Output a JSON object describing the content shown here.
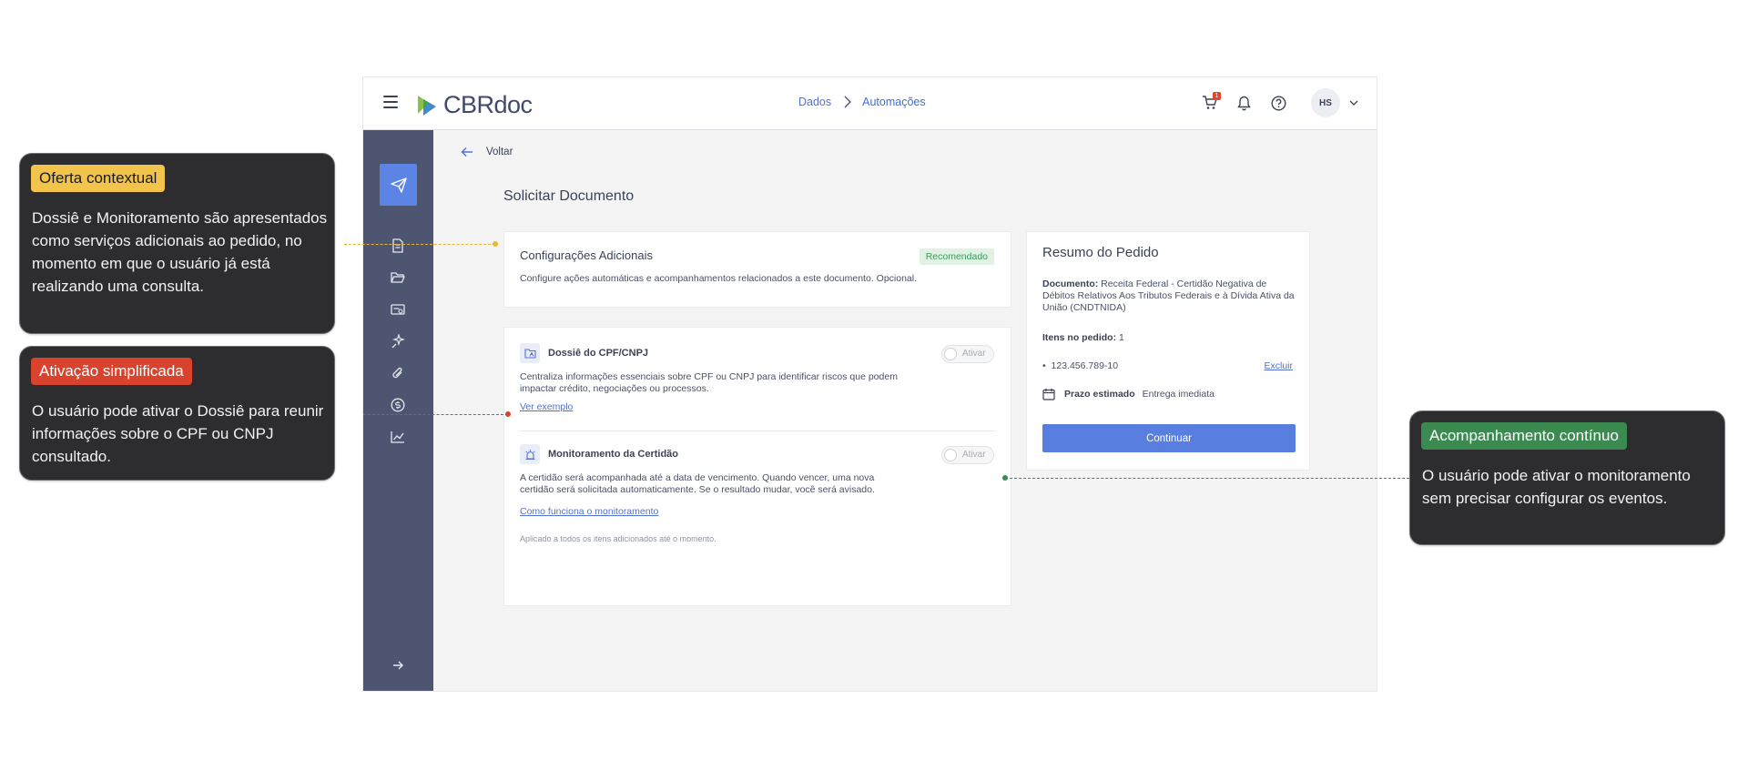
{
  "app": {
    "logo": {
      "prefix": "CBR",
      "suffix": "doc"
    },
    "breadcrumb": {
      "item1": "Dados",
      "item2": "Automações"
    },
    "header": {
      "cart_count": "1",
      "avatar_initials": "HS"
    },
    "back_label": "Voltar",
    "page_title": "Solicitar Documento",
    "additional_config": {
      "title": "Configurações Adicionais",
      "badge": "Recomendado",
      "description": "Configure ações automáticas e acompanhamentos relacionados a este documento. Opcional."
    },
    "services": {
      "dossie": {
        "name": "Dossiê do CPF/CNPJ",
        "toggle_label": "Ativar",
        "description": "Centraliza informações essenciais sobre CPF ou CNPJ para identificar riscos que podem impactar crédito, negociações ou processos.",
        "link": "Ver exemplo"
      },
      "monitoring": {
        "name": "Monitoramento da Certidão",
        "toggle_label": "Ativar",
        "description": "A certidão será acompanhada até a data de vencimento. Quando vencer, uma nova certidão será solicitada automaticamente. Se o resultado mudar, você será avisado.",
        "link": "Como funciona o monitoramento"
      },
      "footnote": "Aplicado a todos os itens adicionados até o momento."
    },
    "summary": {
      "title": "Resumo do Pedido",
      "document_label": "Documento:",
      "document_value": "Receita Federal - Certidão Negativa de Débitos Relativos Aos Tributos Federais e à Dívida Ativa da União (CNDTNIDA)",
      "items_label": "Itens no pedido:",
      "items_value": "1",
      "item_id": "123.456.789-10",
      "remove_label": "Excluir",
      "deadline_label": "Prazo estimado",
      "deadline_value": "Entrega imediata",
      "continue_label": "Continuar"
    }
  },
  "annotations": {
    "contextual_offer": {
      "tag": "Oferta contextual",
      "text": "Dossiê e Monitoramento são apresentados como serviços adicionais ao pedido, no momento em que o usuário já está realizando uma consulta.",
      "color": "#f3c44b"
    },
    "simplified_activation": {
      "tag": "Ativação simplificada",
      "text": "O usuário pode ativar o Dossiê para reunir informações sobre o CPF ou CNPJ consultado.",
      "color": "#d9432e"
    },
    "continuous_tracking": {
      "tag": "Acompanhamento contínuo",
      "text": "O usuário pode ativar o monitoramento sem precisar configurar os eventos.",
      "color": "#3b8a50"
    }
  }
}
